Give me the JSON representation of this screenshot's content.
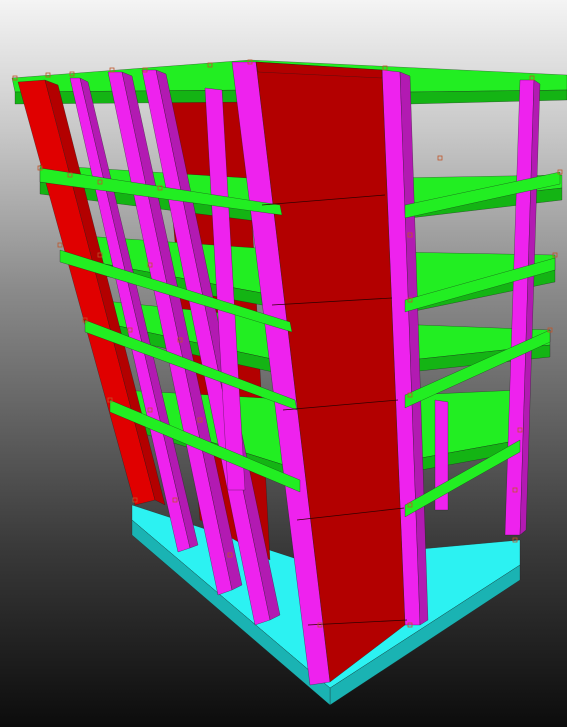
{
  "viewer": {
    "background_top": "#f4f4f4",
    "background_bottom": "#0c0c0c"
  },
  "model": {
    "description_free": true,
    "floors_visible": 6,
    "colors": {
      "slab": "#22ee22",
      "slab_side": "#14b414",
      "column": "#ee22ee",
      "column_side": "#b21ab2",
      "shear_wall": "#b30000",
      "shear_wall_side": "#e00000",
      "foundation": "#2cf2f2",
      "foundation_side": "#1ab3b3",
      "node_marker": "#c0552a"
    }
  }
}
